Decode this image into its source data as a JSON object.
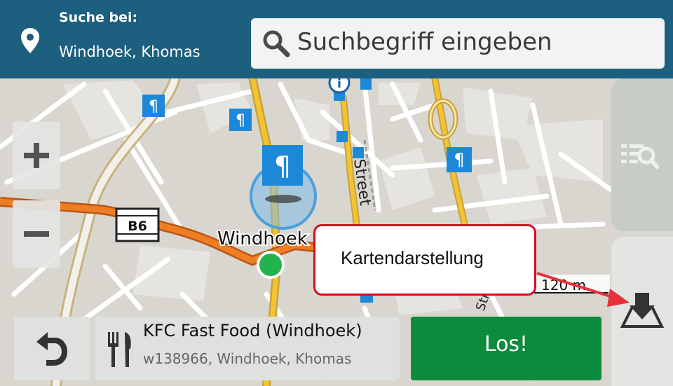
{
  "header": {
    "search_at_label": "Suche bei:",
    "location": "Windhoek, Khomas",
    "location_icon": "map-pin-icon",
    "search_placeholder": "Suchbegriff eingeben",
    "search_icon": "magnifier-icon",
    "bg_color": "#1d5f7e"
  },
  "map": {
    "city_label": "Windhoek",
    "road_shield": "B6",
    "street_label": "Street",
    "street_label_2": "Street",
    "scale_label": "120 m",
    "poi_icon": "restaurant-icon"
  },
  "zoom": {
    "in_icon": "plus-icon",
    "out_icon": "minus-icon"
  },
  "side_panel": {
    "list_view_icon": "list-search-icon",
    "map_view_icon": "map-view-icon"
  },
  "poi": {
    "name": "KFC Fast Food (Windhoek)",
    "address": "w138966, Windhoek, Khomas",
    "icon": "restaurant-icon"
  },
  "actions": {
    "go_label": "Los!",
    "go_color": "#0b8c3c",
    "back_icon": "back-arrow-icon"
  },
  "annotation": {
    "text": "Kartendarstellung",
    "border_color": "#d80c1d"
  }
}
